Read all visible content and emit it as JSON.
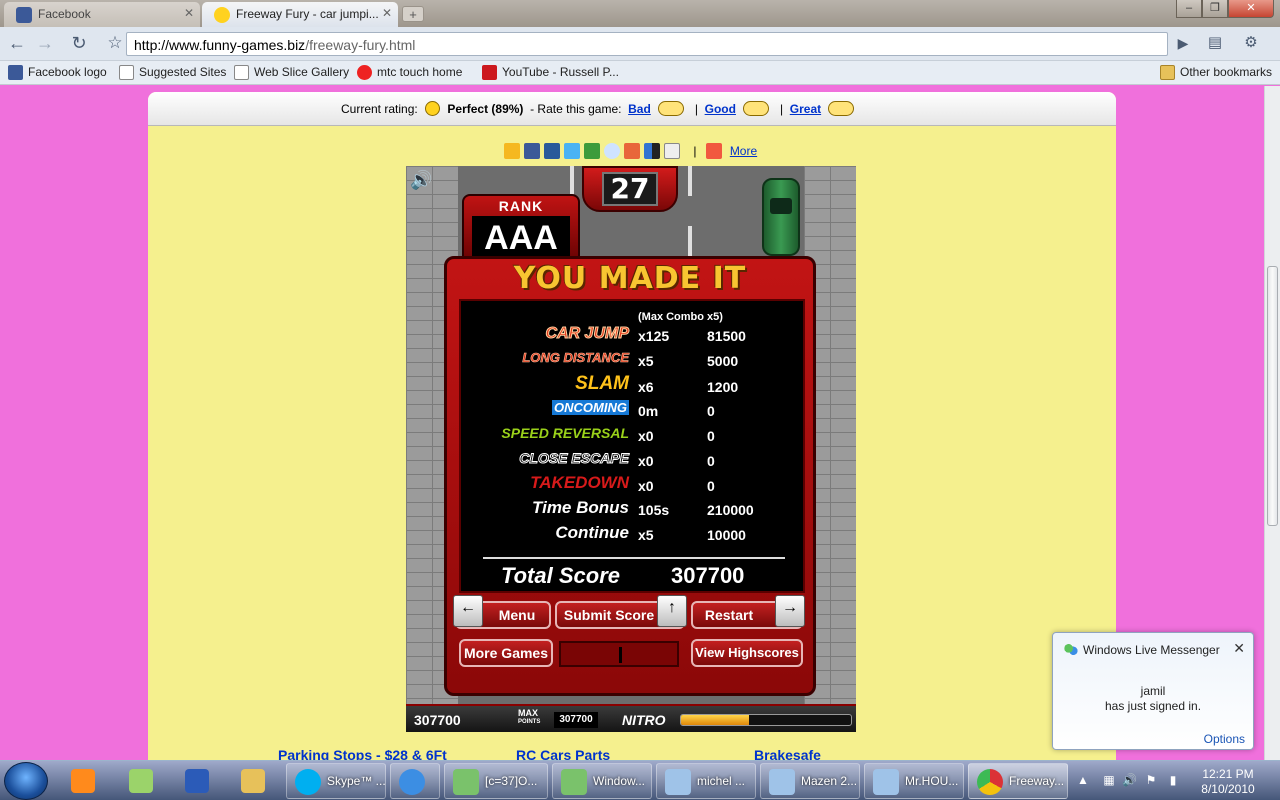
{
  "browser": {
    "tabs": [
      {
        "label": "Facebook",
        "icon": "facebook-icon",
        "active": false
      },
      {
        "label": "Freeway Fury - car jumpi...",
        "icon": "smiley-favicon-icon",
        "active": true
      }
    ],
    "url_host": "http://www.funny-games.biz",
    "url_path": "/freeway-fury.html",
    "bookmarks": [
      {
        "label": "Facebook logo",
        "icon": "facebook-icon"
      },
      {
        "label": "Suggested Sites",
        "icon": "page-icon"
      },
      {
        "label": "Web Slice Gallery",
        "icon": "page-icon"
      },
      {
        "label": "mtc touch  home",
        "icon": "mtc-icon"
      },
      {
        "label": "YouTube - Russell P...",
        "icon": "youtube-icon"
      }
    ],
    "other_bookmarks": "Other bookmarks"
  },
  "rating": {
    "current_label": "Current rating:",
    "current_value": "Perfect (89%)",
    "rate_label": "- Rate this game:",
    "bad": "Bad",
    "good": "Good",
    "great": "Great",
    "sep": "|"
  },
  "share": {
    "more": "More",
    "sep": "|"
  },
  "game": {
    "timer": "27",
    "rank_label": "RANK",
    "rank_value": "AAA",
    "heading": "YOU MADE IT",
    "max_combo": "(Max Combo x5)",
    "rows": [
      {
        "label": "CAR JUMP",
        "mult": "x125",
        "value": "81500",
        "style": "carjump"
      },
      {
        "label": "LONG DISTANCE",
        "mult": "x5",
        "value": "5000",
        "style": "long"
      },
      {
        "label": "SLAM",
        "mult": "x6",
        "value": "1200",
        "style": "slam"
      },
      {
        "label": "ONCOMING",
        "mult": "0m",
        "value": "0",
        "style": "oncoming"
      },
      {
        "label": "SPEED REVERSAL",
        "mult": "x0",
        "value": "0",
        "style": "speed"
      },
      {
        "label": "CLOSE ESCAPE",
        "mult": "x0",
        "value": "0",
        "style": "close"
      },
      {
        "label": "TAKEDOWN",
        "mult": "x0",
        "value": "0",
        "style": "takedown"
      },
      {
        "label": "Time Bonus",
        "mult": "105s",
        "value": "210000",
        "style": "plain"
      },
      {
        "label": "Continue",
        "mult": "x5",
        "value": "10000",
        "style": "plain"
      }
    ],
    "total_label": "Total Score",
    "total_value": "307700",
    "buttons": {
      "menu": "Menu",
      "submit": "Submit Score",
      "restart": "Restart",
      "more_games": "More Games",
      "highscores": "View Highscores"
    },
    "hud": {
      "score": "307700",
      "max_line1": "MAX",
      "max_line2": "POINTS",
      "max_value": "307700",
      "nitro_label": "NITRO",
      "nitro_level": 0.4
    }
  },
  "page_links": [
    "Parking Stops - $28 & 6Ft",
    "RC Cars Parts",
    "Brakesafe"
  ],
  "toast": {
    "title": "Windows Live Messenger",
    "user": "jamil",
    "message": "has just signed in.",
    "options": "Options"
  },
  "taskbar": {
    "tasks": [
      {
        "label": "Skype™ ...",
        "icon": "skype-icon"
      },
      {
        "label": "",
        "icon": "ie-icon"
      },
      {
        "label": "[c=37]O...",
        "icon": "messenger-icon"
      },
      {
        "label": "Window...",
        "icon": "messenger-icon"
      },
      {
        "label": "michel ...",
        "icon": "messenger-icon"
      },
      {
        "label": "Mazen 2...",
        "icon": "messenger-icon"
      },
      {
        "label": "Mr.HOU...",
        "icon": "messenger-icon"
      },
      {
        "label": "Freeway...",
        "icon": "chrome-icon"
      }
    ],
    "time": "12:21 PM",
    "date": "8/10/2010"
  }
}
